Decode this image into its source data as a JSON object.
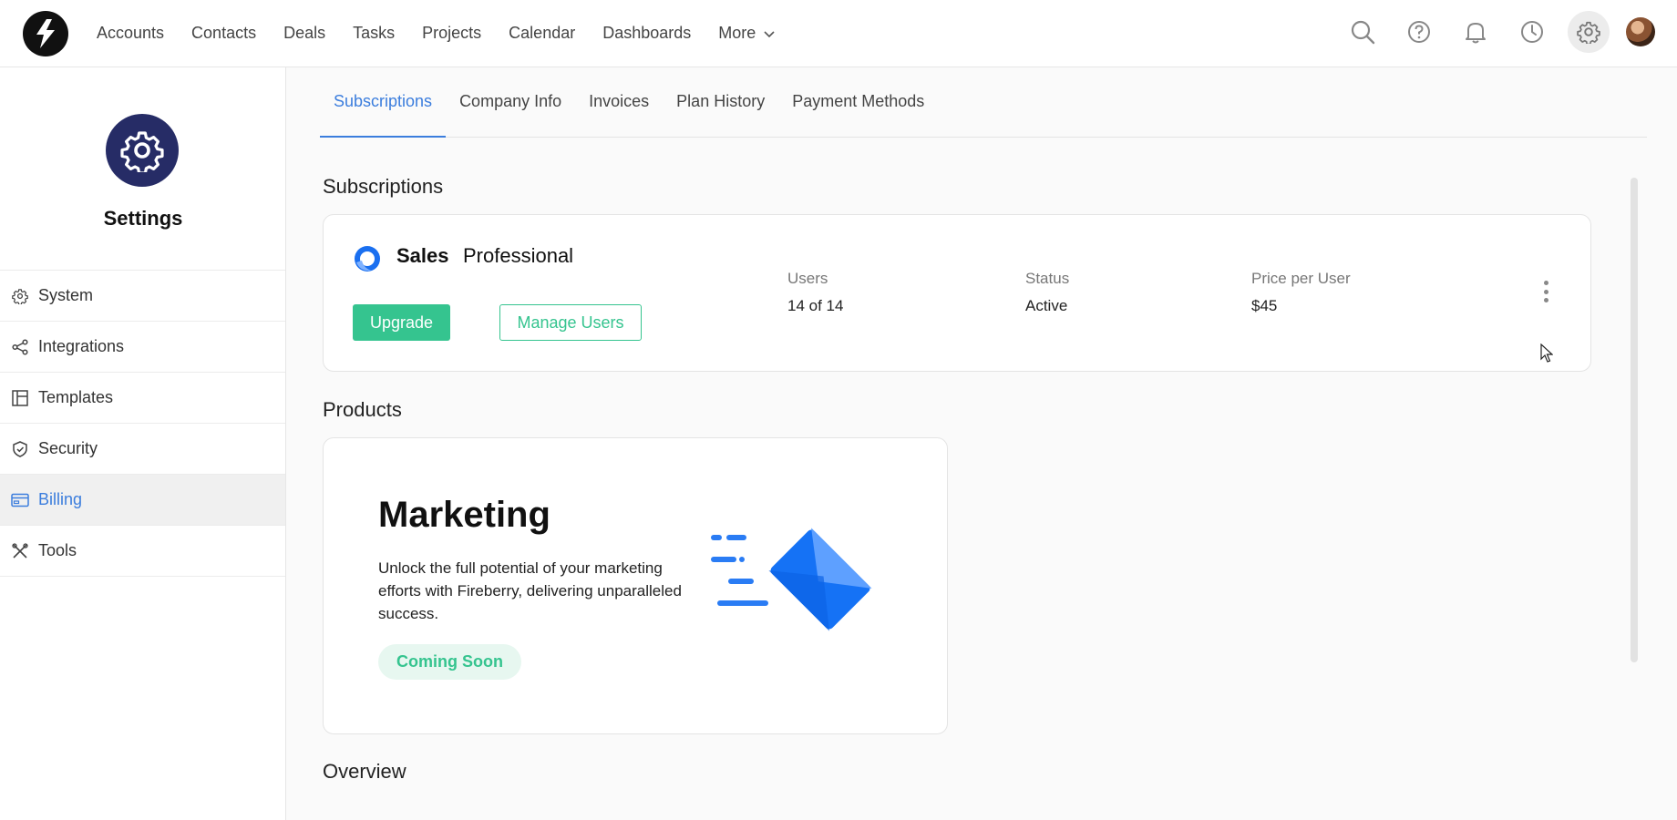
{
  "nav": {
    "items": [
      "Accounts",
      "Contacts",
      "Deals",
      "Tasks",
      "Projects",
      "Calendar",
      "Dashboards"
    ],
    "more_label": "More"
  },
  "icons": {
    "top": [
      "search-icon",
      "help-icon",
      "bell-icon",
      "clock-icon",
      "gear-icon"
    ]
  },
  "sidebar": {
    "title": "Settings",
    "items": [
      {
        "label": "System",
        "icon": "gear-icon"
      },
      {
        "label": "Integrations",
        "icon": "share-icon"
      },
      {
        "label": "Templates",
        "icon": "layout-icon"
      },
      {
        "label": "Security",
        "icon": "shield-icon"
      },
      {
        "label": "Billing",
        "icon": "card-icon",
        "active": true
      },
      {
        "label": "Tools",
        "icon": "tools-icon"
      }
    ]
  },
  "tabs": [
    "Subscriptions",
    "Company Info",
    "Invoices",
    "Plan History",
    "Payment Methods"
  ],
  "subscriptions": {
    "title": "Subscriptions",
    "product": "Sales",
    "plan": "Professional",
    "upgrade_label": "Upgrade",
    "manage_label": "Manage Users",
    "users_label": "Users",
    "users_value": "14 of 14",
    "status_label": "Status",
    "status_value": "Active",
    "price_label": "Price per User",
    "price_value": "$45"
  },
  "products": {
    "title": "Products",
    "card_title": "Marketing",
    "card_desc": "Unlock the full potential of your marketing efforts with Fireberry, delivering unparalleled success.",
    "badge": "Coming Soon"
  },
  "overview": {
    "title": "Overview"
  },
  "colors": {
    "accent_blue": "#3b7ddd",
    "green": "#35c48f",
    "settings_badge": "#262c66"
  }
}
